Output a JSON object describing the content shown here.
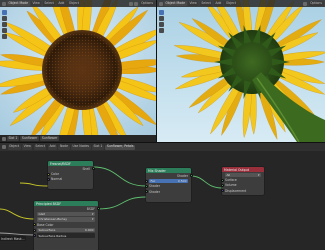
{
  "viewport_left": {
    "header": {
      "mode": "Object Mode",
      "view": "View",
      "select": "Select",
      "add": "Add",
      "object": "Object",
      "options": "Options"
    },
    "footer": {
      "slot": "Slot 1",
      "material": "Sunflower",
      "name": "Sunflower"
    }
  },
  "viewport_right": {
    "header": {
      "mode": "Object Mode",
      "view": "View",
      "select": "Select",
      "add": "Add",
      "object": "Object",
      "options": "Options"
    },
    "footer": {
      "slot": "Slot 1",
      "material": "Sunflower",
      "name": "Sunflower, Petals"
    }
  },
  "node_editor": {
    "header": {
      "editor": "Object",
      "view": "View",
      "select": "Select",
      "add": "Add",
      "node": "Node",
      "use_nodes": "Use Nodes",
      "slot": "Slot 1",
      "material": "Sunflower, Petals"
    },
    "nodes": {
      "fresnel": {
        "title": "Fresnel/BSDF",
        "output": "Shell",
        "inputs": [
          "Color",
          "Normal"
        ]
      },
      "mix_shader": {
        "title": "Mix Shader",
        "output": "Shader",
        "fac_label": "Fac",
        "fac_value": "0.500",
        "inputs": [
          "Shader",
          "Shader"
        ]
      },
      "material_output": {
        "title": "Material Output",
        "target": "All",
        "inputs": [
          "Surface",
          "Volume",
          "Displacement"
        ]
      },
      "principled": {
        "title": "Principled BSDF",
        "output": "BSDF",
        "dist": "GGX",
        "sss": "Christensen-Burley",
        "base_color": "Base Color",
        "subsurface_label": "Subsurface",
        "subsurface_value": "0.000",
        "subsurface_radius": "Subsurface Radius"
      }
    },
    "edge_label": "Indirect Mask..."
  },
  "colors": {
    "ui_bg": "#262626",
    "header_bg": "#303030",
    "shader_header": "#2c7d5a",
    "output_header": "#9a2f3c",
    "sky": "#b9d8ea",
    "petal_yellow": "#f2c21a",
    "disc_brown": "#4a2a10"
  }
}
